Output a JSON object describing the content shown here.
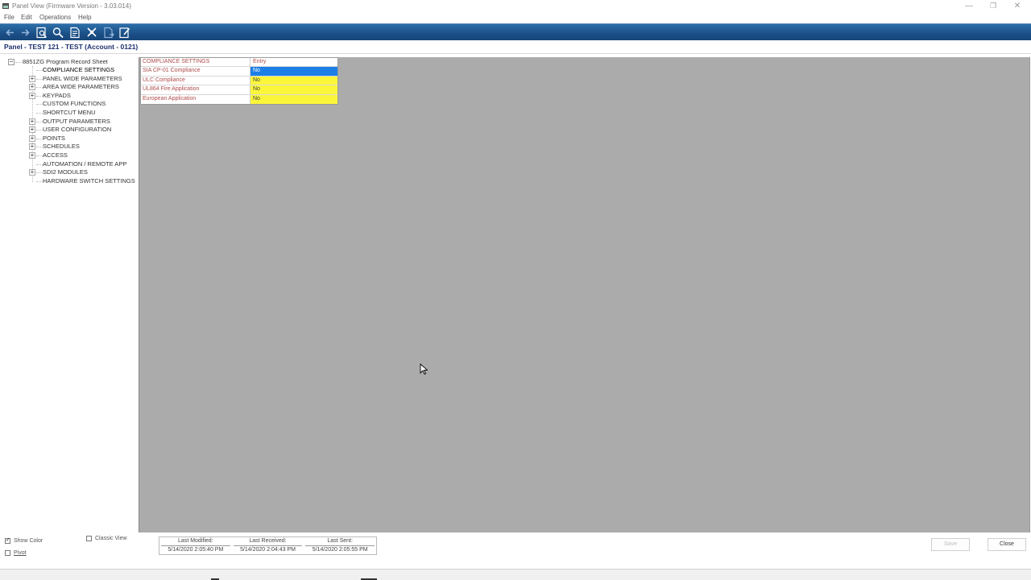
{
  "window": {
    "title": "Panel View (Firmware Version - 3.03.014)",
    "controls": {
      "minimize": "—",
      "maximize": "❐",
      "close": "✕"
    }
  },
  "menu": [
    "File",
    "Edit",
    "Operations",
    "Help"
  ],
  "toolbar": {
    "icons": [
      "back-arrow-icon",
      "forward-arrow-icon",
      "print-preview-icon",
      "search-icon",
      "document-icon",
      "tools-icon",
      "export-document-icon",
      "edit-note-icon"
    ]
  },
  "panel_title": "Panel - TEST 121 - TEST (Account - 0121)",
  "tree": {
    "root": "8851ZG Program Record Sheet",
    "items": [
      {
        "label": "COMPLIANCE SETTINGS",
        "expandable": false,
        "selected": true
      },
      {
        "label": "PANEL WIDE PARAMETERS",
        "expandable": true
      },
      {
        "label": "AREA WIDE PARAMETERS",
        "expandable": true
      },
      {
        "label": "KEYPADS",
        "expandable": true
      },
      {
        "label": "CUSTOM FUNCTIONS",
        "expandable": false
      },
      {
        "label": "SHORTCUT MENU",
        "expandable": false
      },
      {
        "label": "OUTPUT PARAMETERS",
        "expandable": true
      },
      {
        "label": "USER CONFIGURATION",
        "expandable": true
      },
      {
        "label": "POINTS",
        "expandable": true
      },
      {
        "label": "SCHEDULES",
        "expandable": true
      },
      {
        "label": "ACCESS",
        "expandable": true
      },
      {
        "label": "AUTOMATION / REMOTE APP",
        "expandable": false
      },
      {
        "label": "SDI2 MODULES",
        "expandable": true
      },
      {
        "label": "HARDWARE SWITCH SETTINGS",
        "expandable": false
      }
    ]
  },
  "grid": {
    "header": {
      "name": "COMPLIANCE SETTINGS",
      "value": "Entry"
    },
    "rows": [
      {
        "name": "SIA CP-01 Compliance",
        "value": "No",
        "state": "selected"
      },
      {
        "name": "ULC Compliance",
        "value": "No",
        "state": "highlight"
      },
      {
        "name": "UL864 Fire Application",
        "value": "No",
        "state": "highlight"
      },
      {
        "name": "European Application",
        "value": "No",
        "state": "highlight"
      }
    ],
    "colors": {
      "highlight": "#fbf63a",
      "selected": "#1d7fe6"
    }
  },
  "bottom": {
    "show_color": {
      "label": "Show Color",
      "checked": true
    },
    "pivot": {
      "label": "Pivot",
      "checked": false
    },
    "classic_view": {
      "label": "Classic View",
      "checked": false
    },
    "status": [
      {
        "label": "Last Modified:",
        "value": "5/14/2020 2:05:40 PM"
      },
      {
        "label": "Last Received:",
        "value": "5/14/2020 2:04:43 PM"
      },
      {
        "label": "Last Sent:",
        "value": "5/14/2020 2:05:55 PM"
      }
    ],
    "save_label": "Save",
    "close_label": "Close"
  }
}
